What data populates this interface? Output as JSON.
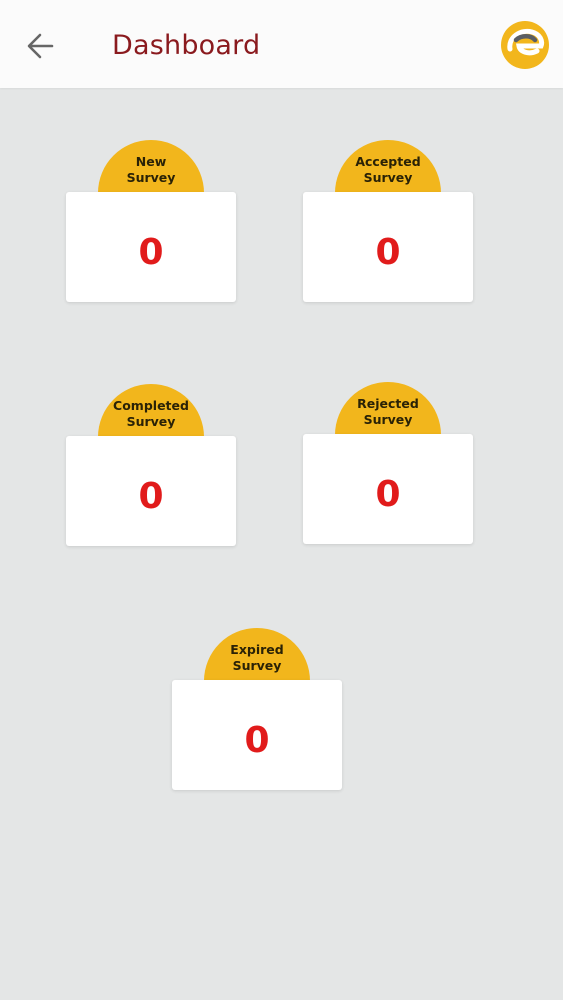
{
  "header": {
    "title": "Dashboard",
    "back_icon": "arrow-left-icon",
    "logo_icon": "brand-logo-icon",
    "title_color": "#8a1a1e"
  },
  "colors": {
    "accent": "#f2b61c",
    "count": "#e11b1b",
    "background": "#e4e6e6",
    "card": "#ffffff"
  },
  "cards": [
    {
      "line1": "New",
      "line2": "Survey",
      "count": "0"
    },
    {
      "line1": "Accepted",
      "line2": "Survey",
      "count": "0"
    },
    {
      "line1": "Completed",
      "line2": "Survey",
      "count": "0"
    },
    {
      "line1": "Rejected",
      "line2": "Survey",
      "count": "0"
    },
    {
      "line1": "Expired",
      "line2": "Survey",
      "count": "0"
    }
  ]
}
